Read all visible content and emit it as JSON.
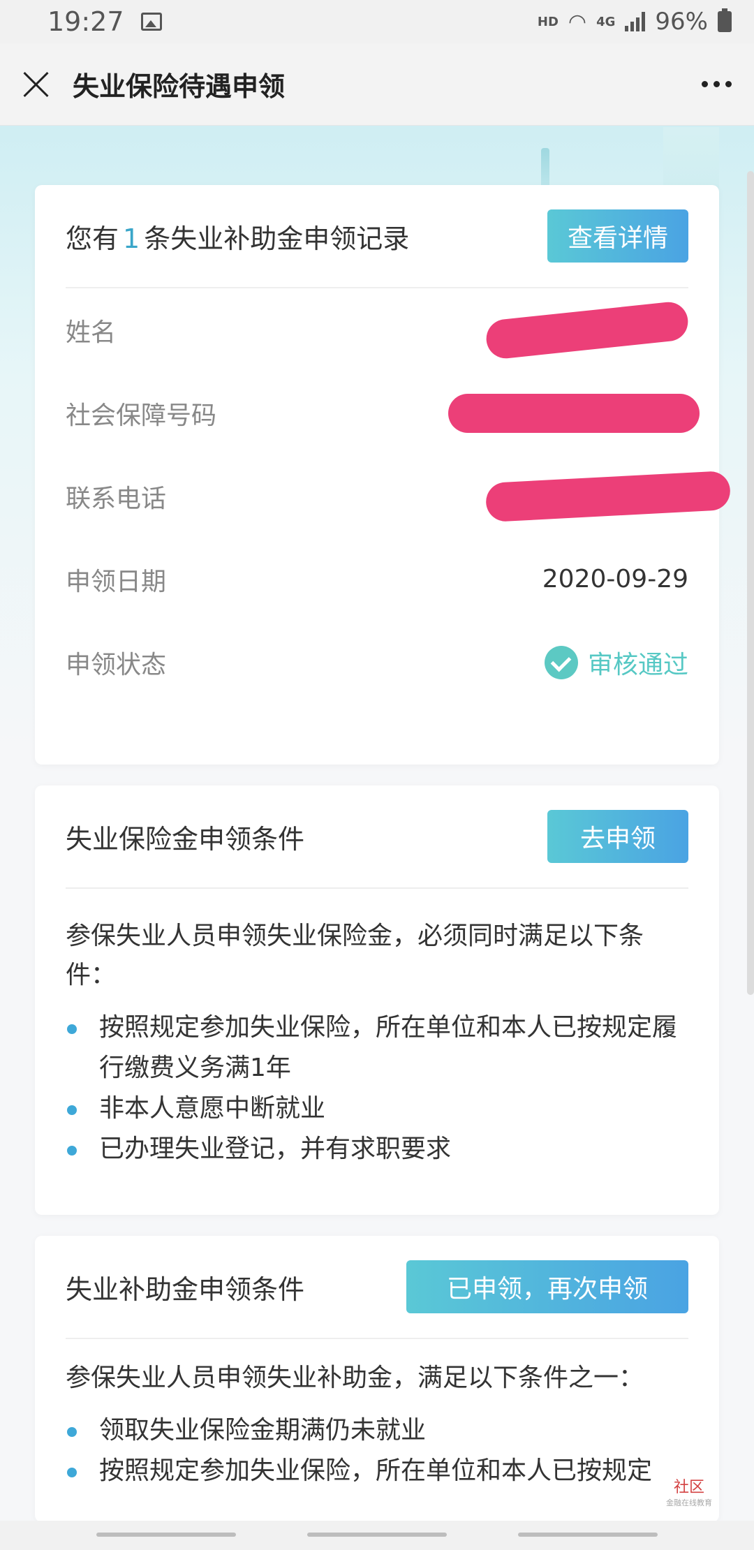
{
  "status_bar": {
    "time": "19:27",
    "hd": "HD",
    "network": "4G",
    "battery": "96%",
    "icons": [
      "image-icon",
      "wifi-icon",
      "signal-icon",
      "battery-icon"
    ]
  },
  "header": {
    "title": "失业保险待遇申领",
    "close_icon": "close-icon",
    "more_icon": "more-icon"
  },
  "record_card": {
    "title_prefix": "您有",
    "count": "1",
    "title_suffix": "条失业补助金申领记录",
    "detail_button": "查看详情",
    "fields": {
      "name_label": "姓名",
      "ssn_label": "社会保障号码",
      "phone_label": "联系电话",
      "date_label": "申领日期",
      "date_value": "2020-09-29",
      "status_label": "申领状态",
      "status_value": "审核通过"
    },
    "status_color": "#56c8c4"
  },
  "insurance_card": {
    "title": "失业保险金申领条件",
    "button": "去申领",
    "intro": "参保失业人员申领失业保险金，必须同时满足以下条件：",
    "conditions": [
      "按照规定参加失业保险，所在单位和本人已按规定履行缴费义务满1年",
      "非本人意愿中断就业",
      "已办理失业登记，并有求职要求"
    ]
  },
  "subsidy_card": {
    "title": "失业补助金申领条件",
    "button": "已申领，再次申领",
    "intro": "参保失业人员申领失业补助金，满足以下条件之一：",
    "conditions": [
      "领取失业保险金期满仍未就业",
      "按照规定参加失业保险，所在单位和本人已按规定"
    ]
  },
  "watermark": {
    "text": "社区",
    "sub": "金融在线教育"
  },
  "colors": {
    "accent": "#3aa6c9",
    "button_gradient_start": "#5ac8d6",
    "button_gradient_end": "#4aa3e3",
    "redaction": "#ec3f78"
  }
}
